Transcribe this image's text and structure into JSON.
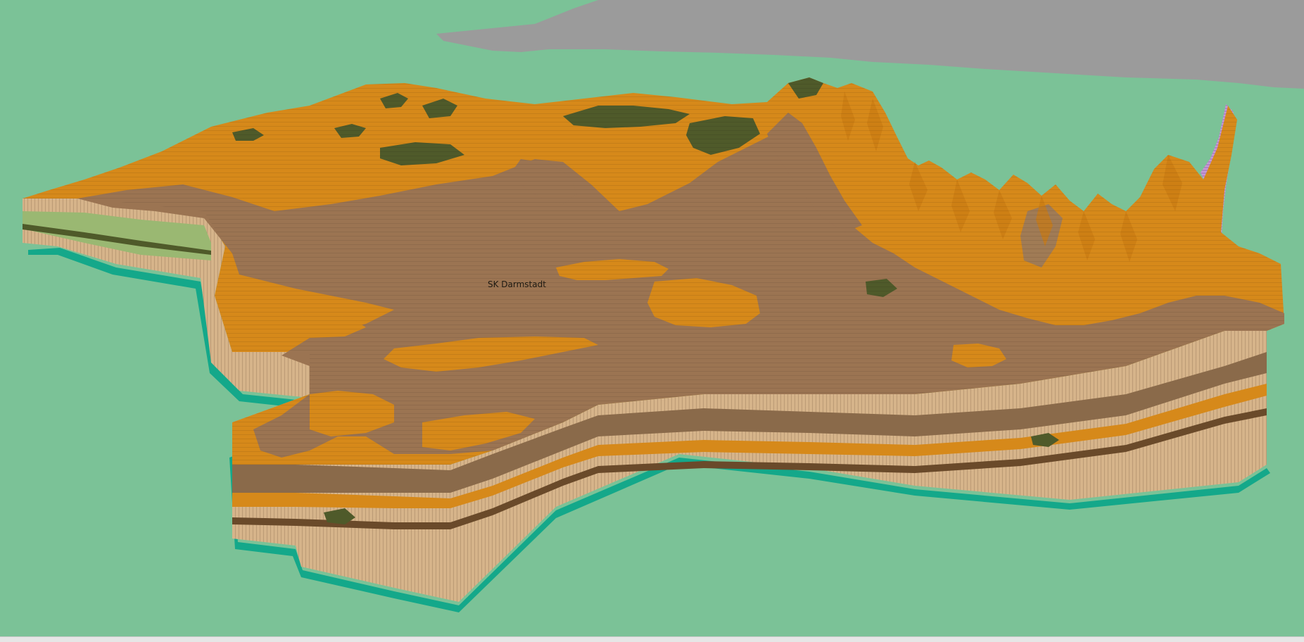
{
  "map": {
    "place_label": "SK Darmstadt",
    "status_text": ""
  },
  "colors": {
    "background": "#7bc297",
    "cloud": "#9b9b9b",
    "surface_orange": "#d6891a",
    "surface_brown": "#9b7452",
    "forest": "#4f5a2a",
    "side_tan": "#d6b48a",
    "side_brown": "#8a6a4a",
    "base_teal": "#14a88a",
    "green_layer": "#9ab872",
    "violet_wall": "#c79ad7"
  }
}
